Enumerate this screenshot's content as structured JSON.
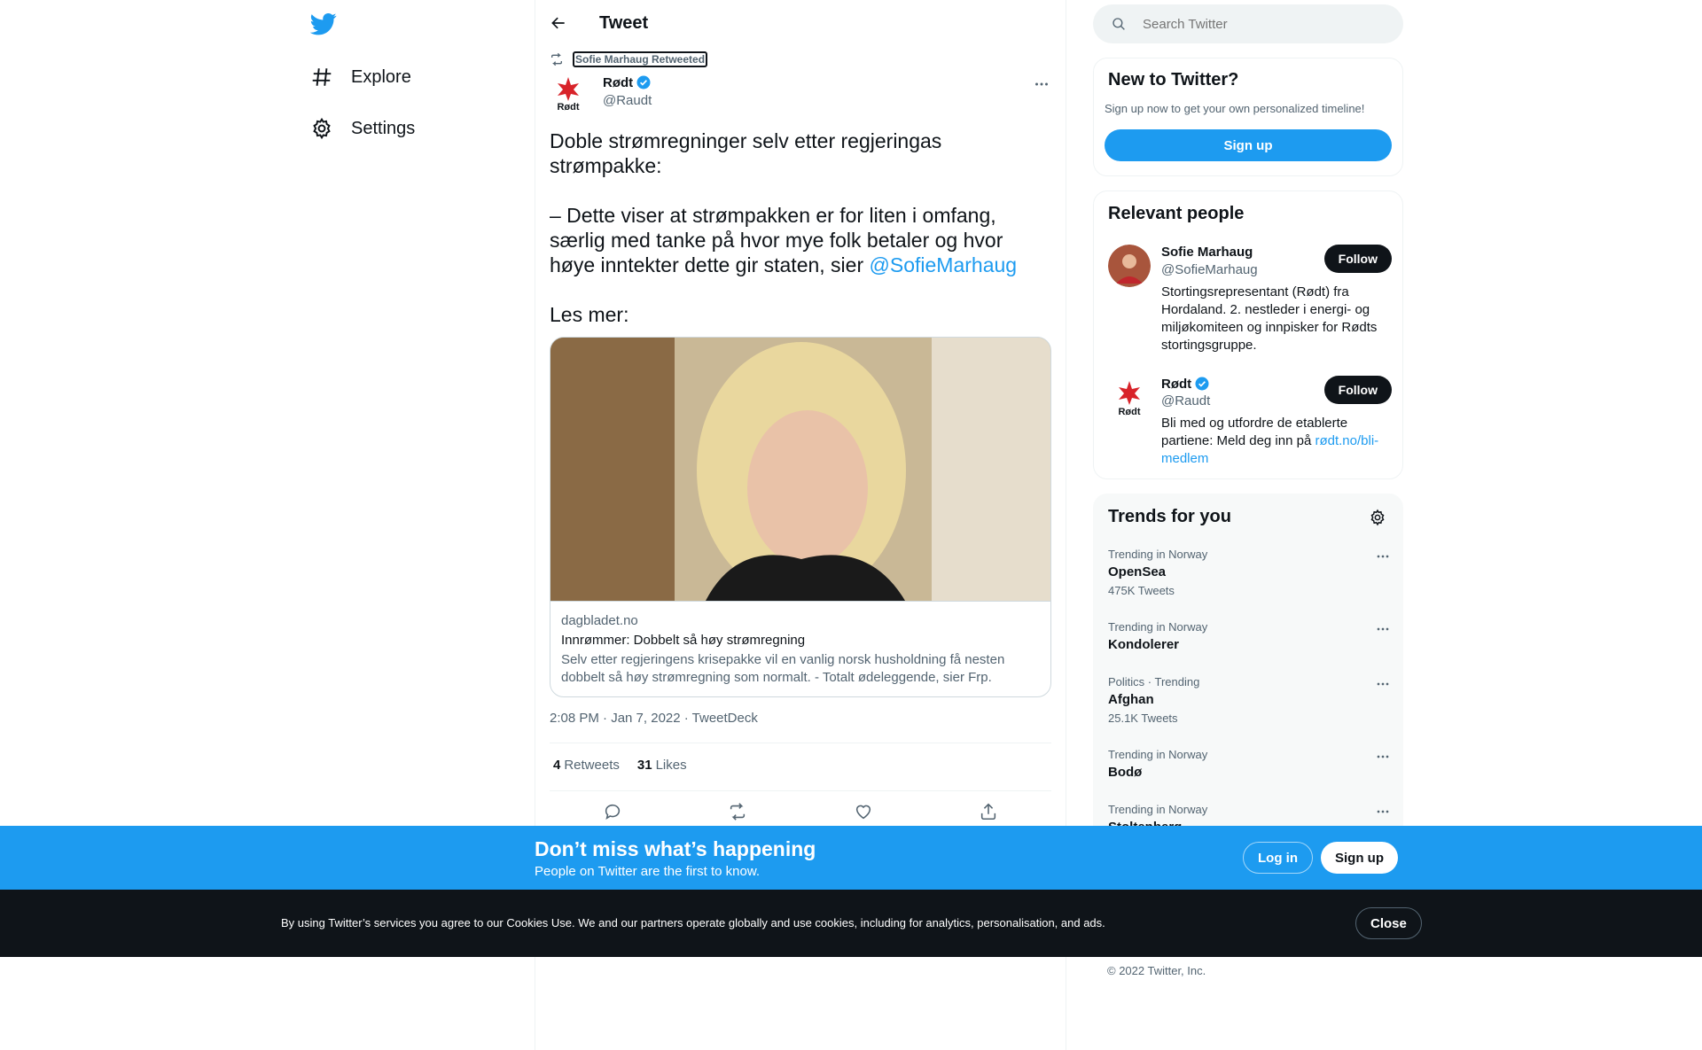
{
  "colors": {
    "brand": "#1d9bf0",
    "text": "#0f1419",
    "muted": "#536471",
    "dark": "#0f1419"
  },
  "nav": {
    "logo_icon": "twitter-bird-icon",
    "items": [
      {
        "label": "Explore",
        "icon": "hashtag-icon"
      },
      {
        "label": "Settings",
        "icon": "gear-icon"
      }
    ]
  },
  "header": {
    "title": "Tweet",
    "back_icon": "back-arrow-icon"
  },
  "tweet": {
    "retweeted_by": "Sofie Marhaug Retweeted",
    "author_name": "Rødt",
    "author_handle": "@Raudt",
    "avatar_text": "Rødt",
    "text_before_mention": "Doble strømregninger selv etter regjeringas strømpakke:\n\n– Dette viser at strømpakken er for liten i omfang, særlig med tanke på hvor mye folk betaler og hvor høye inntekter dette gir staten, sier ",
    "mention": "@SofieMarhaug",
    "text_after_mention": "\n\nLes mer:",
    "card": {
      "domain": "dagbladet.no",
      "title": "Innrømmer: Dobbelt så høy strømregning",
      "description": "Selv etter regjeringens krisepakke vil en vanlig norsk husholdning få nesten dobbelt så høy strømregning som normalt. - Totalt ødeleggende, sier Frp."
    },
    "meta": "2:08 PM · Jan 7, 2022 · TweetDeck",
    "retweets_count": "4",
    "retweets_label": "Retweets",
    "likes_count": "31",
    "likes_label": "Likes"
  },
  "search": {
    "placeholder": "Search Twitter"
  },
  "new_to_twitter": {
    "title": "New to Twitter?",
    "subtitle": "Sign up now to get your own personalized timeline!",
    "button": "Sign up"
  },
  "relevant_people": {
    "title": "Relevant people",
    "people": [
      {
        "name": "Sofie Marhaug",
        "handle": "@SofieMarhaug",
        "bio": "Stortingsrepresentant (Rødt) fra Hordaland. 2. nestleder i energi- og miljøkomiteen og innpisker for Rødts stortingsgruppe.",
        "follow": "Follow",
        "verified": false
      },
      {
        "name": "Rødt",
        "handle": "@Raudt",
        "bio": "Bli med og utfordre de etablerte partiene: Meld deg inn på ",
        "bio_link": "rødt.no/bli-medlem",
        "follow": "Follow",
        "verified": true
      }
    ]
  },
  "trends": {
    "title": "Trends for you",
    "items": [
      {
        "context": "Trending in Norway",
        "name": "OpenSea",
        "count": "475K Tweets"
      },
      {
        "context": "Trending in Norway",
        "name": "Kondolerer",
        "count": ""
      },
      {
        "context": "Politics · Trending",
        "name": "Afghan",
        "count": "25.1K Tweets"
      },
      {
        "context": "Trending in Norway",
        "name": "Bodø",
        "count": ""
      },
      {
        "context": "Trending in Norway",
        "name": "Stoltenberg",
        "count": ""
      }
    ]
  },
  "copyright": "© 2022 Twitter, Inc.",
  "banner": {
    "title": "Don’t miss what’s happening",
    "subtitle": "People on Twitter are the first to know.",
    "login": "Log in",
    "signup": "Sign up"
  },
  "cookie": {
    "text": "By using Twitter’s services you agree to our Cookies Use. We and our partners operate globally and use cookies, including for analytics, personalisation, and ads.",
    "close": "Close"
  }
}
